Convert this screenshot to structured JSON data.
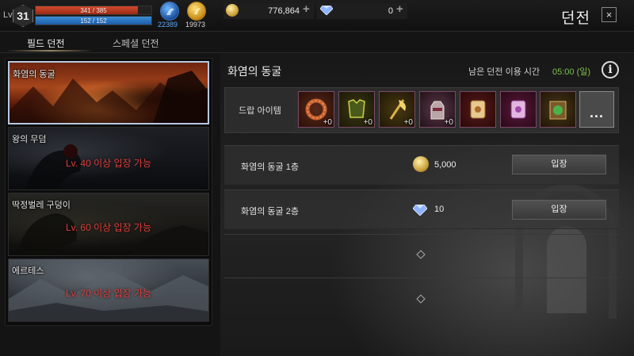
{
  "player": {
    "level_label": "Lv",
    "level": "31",
    "hp_text": "341 / 385",
    "hp_ratio": 0.886,
    "mp_text": "152 / 152",
    "mp_ratio": 1.0,
    "stat_blue": "22389",
    "stat_gold": "19973"
  },
  "currency": {
    "gold": "776,864",
    "diamond": "0",
    "plus": "+"
  },
  "header": {
    "title": "던전",
    "close": "×"
  },
  "tabs": [
    {
      "label": "필드 던전",
      "active": true
    },
    {
      "label": "스페셜 던전",
      "active": false
    }
  ],
  "dungeon_list": [
    {
      "name": "화염의 동굴",
      "lock_text": "",
      "selected": true
    },
    {
      "name": "왕의 무덤",
      "lock_text": "Lv. 40 이상 입장 가능",
      "selected": false
    },
    {
      "name": "딱정벌레 구덩이",
      "lock_text": "Lv. 60 이상 입장 가능",
      "selected": false
    },
    {
      "name": "에르테스",
      "lock_text": "Lv. 70 이상 입장 가능",
      "selected": false
    }
  ],
  "detail": {
    "title": "화염의 동굴",
    "time_label": "남은 던전 이용 시간",
    "time_value": "05:00 (일)",
    "info_icon": "i",
    "drop_label": "드랍 아이템",
    "drop_items": [
      {
        "icon": "ring-icon",
        "enhance": "+0"
      },
      {
        "icon": "armor-icon",
        "enhance": "+0"
      },
      {
        "icon": "axe-icon",
        "enhance": "+0"
      },
      {
        "icon": "gauntlet-icon",
        "enhance": "+0"
      },
      {
        "icon": "scroll-icon",
        "enhance": ""
      },
      {
        "icon": "scroll-purple-icon",
        "enhance": ""
      },
      {
        "icon": "spellbook-icon",
        "enhance": ""
      }
    ],
    "more_label": "...",
    "floors": [
      {
        "name": "화염의 동굴 1층",
        "cost_type": "gold",
        "cost": "5,000",
        "button": "입장"
      },
      {
        "name": "화염의 동굴 2층",
        "cost_type": "diamond",
        "cost": "10",
        "button": "입장"
      }
    ]
  },
  "colors": {
    "hp": "#c33b20",
    "mp": "#2d74c4",
    "time_green": "#7dc24a",
    "lock_red": "#e03c3c"
  }
}
